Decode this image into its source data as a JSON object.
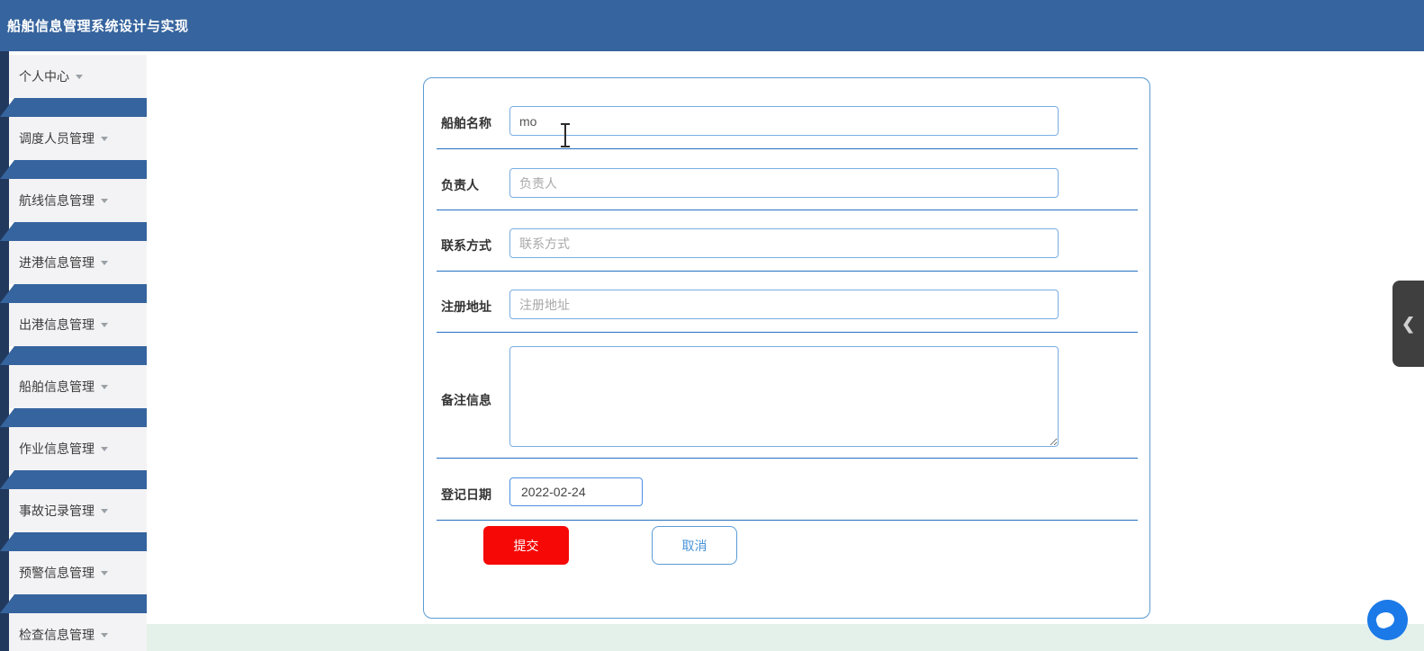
{
  "header": {
    "title": "船舶信息管理系统设计与实现",
    "icons": {
      "fullscreen": "fullscreen-icon",
      "user": "user-icon"
    },
    "bg_color": "#36649e",
    "icon_circle_color": "#2e8be8"
  },
  "sidebar": {
    "items": [
      {
        "label": "个人中心"
      },
      {
        "label": "调度人员管理"
      },
      {
        "label": "航线信息管理"
      },
      {
        "label": "进港信息管理"
      },
      {
        "label": "出港信息管理"
      },
      {
        "label": "船舶信息管理"
      },
      {
        "label": "作业信息管理"
      },
      {
        "label": "事故记录管理"
      },
      {
        "label": "预警信息管理"
      },
      {
        "label": "检查信息管理"
      }
    ],
    "dark_strip_color": "#22395e",
    "band_color": "#36649e",
    "item_bg_color": "#f3f3f5"
  },
  "form": {
    "fields": [
      {
        "label": "船舶名称",
        "value": "mo",
        "placeholder": ""
      },
      {
        "label": "负责人",
        "value": "",
        "placeholder": "负责人"
      },
      {
        "label": "联系方式",
        "value": "",
        "placeholder": "联系方式"
      },
      {
        "label": "注册地址",
        "value": "",
        "placeholder": "注册地址"
      },
      {
        "label": "备注信息",
        "value": "",
        "placeholder": ""
      },
      {
        "label": "登记日期",
        "value": "2022-02-24",
        "placeholder": ""
      }
    ],
    "submit_label": "提交",
    "cancel_label": "取消",
    "card_border_color": "#5a9bd5",
    "input_border_color": "#79aee3",
    "separator_color": "#2570c0",
    "submit_bg_color": "#f50806",
    "cancel_text_color": "#4693d8"
  },
  "overlays": {
    "collapse_chevron": "❮",
    "footer_strip_color": "#e4f1ea",
    "chat_bubble_color": "#1b79e8",
    "handle_bg_color": "#3f3f3f"
  }
}
